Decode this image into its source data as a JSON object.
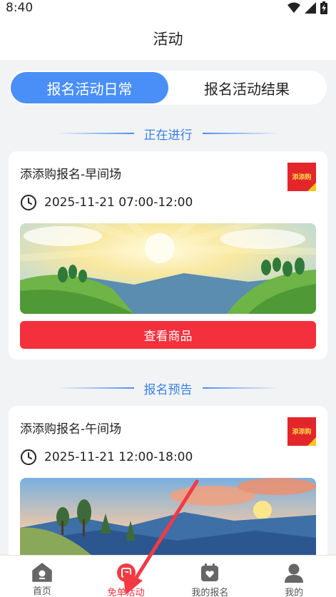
{
  "status_bar": {
    "time": "8:40"
  },
  "header": {
    "title": "活动"
  },
  "tabs": [
    {
      "label": "报名活动日常",
      "active": true
    },
    {
      "label": "报名活动结果",
      "active": false
    }
  ],
  "sections": [
    {
      "heading": "正在进行",
      "card": {
        "title": "添添购报名-早间场",
        "time": "2025-11-21 07:00-12:00",
        "logo_text": "添添购",
        "button_label": "查看商品",
        "banner": "sunrise-landscape"
      }
    },
    {
      "heading": "报名预告",
      "card": {
        "title": "添添购报名-午间场",
        "time": "2025-11-21 12:00-18:00",
        "logo_text": "添添购",
        "banner": "sunset-landscape"
      }
    }
  ],
  "bottom_nav": [
    {
      "label": "首页",
      "icon": "home-icon",
      "active": false
    },
    {
      "label": "免单活动",
      "icon": "activity-icon",
      "active": true
    },
    {
      "label": "我的报名",
      "icon": "calendar-heart-icon",
      "active": false
    },
    {
      "label": "我的",
      "icon": "user-icon",
      "active": false
    }
  ],
  "colors": {
    "accent_blue": "#4a8ff7",
    "button_red": "#f3303c",
    "active_nav_red": "#e8303a",
    "logo_red": "#e3262a"
  }
}
